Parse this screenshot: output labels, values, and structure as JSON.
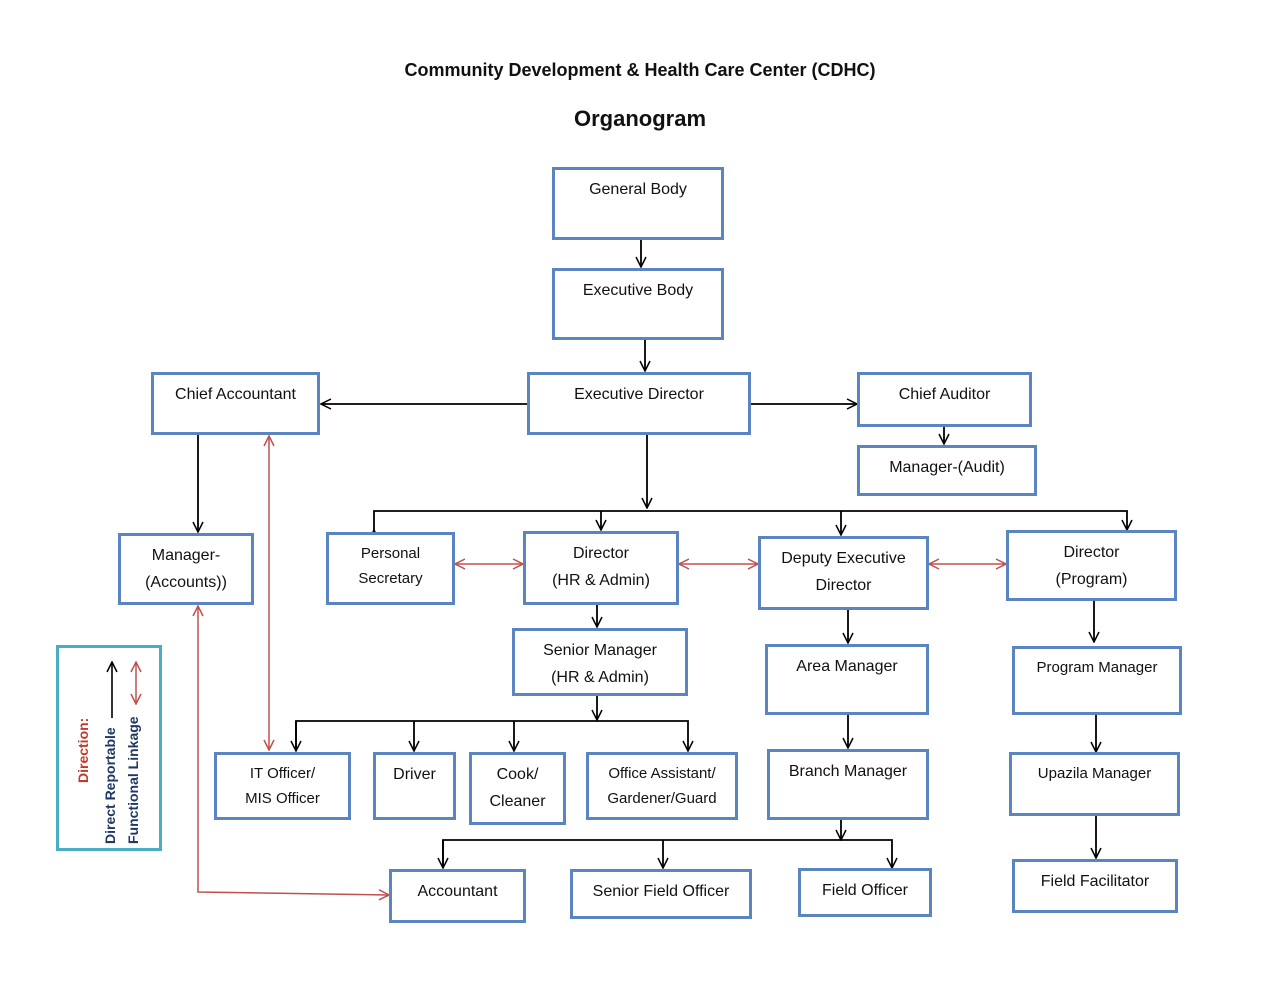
{
  "header": {
    "organization": "Community Development & Health Care Center (CDHC)",
    "subtitle": "Organogram"
  },
  "colors": {
    "box_border": "#5a85c1",
    "direct_line": "#000000",
    "functional_line": "#c0504d",
    "legend_border": "#4bacc6",
    "legend_title": "#c0392b",
    "legend_text": "#1f3864"
  },
  "nodes": {
    "general_body": "General Body",
    "executive_body": "Executive Body",
    "executive_director": "Executive Director",
    "chief_accountant": "Chief Accountant",
    "chief_auditor": "Chief Auditor",
    "manager_audit": "Manager-(Audit)",
    "manager_accounts_l1": "Manager-",
    "manager_accounts_l2": "(Accounts))",
    "personal_secretary_l1": "Personal",
    "personal_secretary_l2": "Secretary",
    "director_hr_l1": "Director",
    "director_hr_l2": "(HR & Admin)",
    "deputy_ed_l1": "Deputy Executive",
    "deputy_ed_l2": "Director",
    "director_program_l1": "Director",
    "director_program_l2": "(Program)",
    "senior_manager_hr_l1": "Senior Manager",
    "senior_manager_hr_l2": "(HR & Admin)",
    "area_manager": "Area Manager",
    "program_manager": "Program Manager",
    "it_officer_l1": "IT Officer/",
    "it_officer_l2": "MIS Officer",
    "driver": "Driver",
    "cook_l1": "Cook/",
    "cook_l2": "Cleaner",
    "office_assistant_l1": "Office Assistant/",
    "office_assistant_l2": "Gardener/Guard",
    "branch_manager": "Branch Manager",
    "upazila_manager": "Upazila Manager",
    "accountant": "Accountant",
    "senior_field_officer": "Senior Field Officer",
    "field_officer": "Field Officer",
    "field_facilitator": "Field Facilitator"
  },
  "legend": {
    "title": "Direction:",
    "direct": "Direct Reportable",
    "functional": "Functional Linkage"
  }
}
